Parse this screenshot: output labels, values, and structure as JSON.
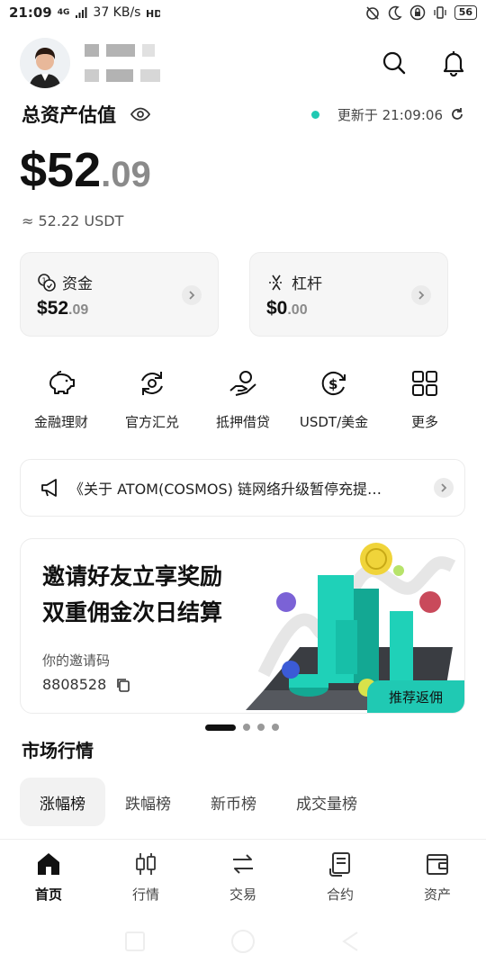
{
  "status_bar": {
    "time": "21:09",
    "network_type": "4G",
    "speed": "37 KB/s",
    "battery": "56"
  },
  "header": {
    "avatar_icon": "user-avatar-icon",
    "search_icon": "search-icon",
    "bell_icon": "bell-icon"
  },
  "assets": {
    "title": "总资产估值",
    "update_label": "更新于 21:09:06",
    "balance_int": "$52",
    "balance_dec": ".09",
    "approx_usdt": "≈ 52.22 USDT"
  },
  "cards": [
    {
      "label": "资金",
      "amount_int": "$52",
      "amount_dec": ".09",
      "icon": "fund-icon"
    },
    {
      "label": "杠杆",
      "amount_int": "$0",
      "amount_dec": ".00",
      "icon": "leverage-icon"
    }
  ],
  "quick_actions": [
    {
      "label": "金融理财",
      "icon": "piggy-bank-icon"
    },
    {
      "label": "官方汇兑",
      "icon": "exchange-cycle-icon"
    },
    {
      "label": "抵押借贷",
      "icon": "loan-hand-icon"
    },
    {
      "label": "USDT/美金",
      "icon": "usd-cycle-icon"
    },
    {
      "label": "更多",
      "icon": "grid-more-icon"
    }
  ],
  "notice": {
    "text": "《关于 ATOM(COSMOS) 链网络升级暂停充提…"
  },
  "banner": {
    "line1": "邀请好友立享奖励",
    "line2": "双重佣金次日结算",
    "invite_label": "你的邀请码",
    "invite_code": "8808528",
    "rebate_badge": "推荐返佣"
  },
  "market": {
    "title": "市场行情",
    "tabs": [
      "涨幅榜",
      "跌幅榜",
      "新币榜",
      "成交量榜"
    ],
    "active_tab": 0
  },
  "bottom_nav": [
    {
      "label": "首页",
      "icon": "home-icon",
      "active": true
    },
    {
      "label": "行情",
      "icon": "candlestick-icon",
      "active": false
    },
    {
      "label": "交易",
      "icon": "swap-icon",
      "active": false
    },
    {
      "label": "合约",
      "icon": "contract-icon",
      "active": false
    },
    {
      "label": "资产",
      "icon": "wallet-icon",
      "active": false
    }
  ],
  "colors": {
    "accent": "#20c9b3",
    "text_primary": "#111111",
    "text_secondary": "#8a8a8a"
  }
}
